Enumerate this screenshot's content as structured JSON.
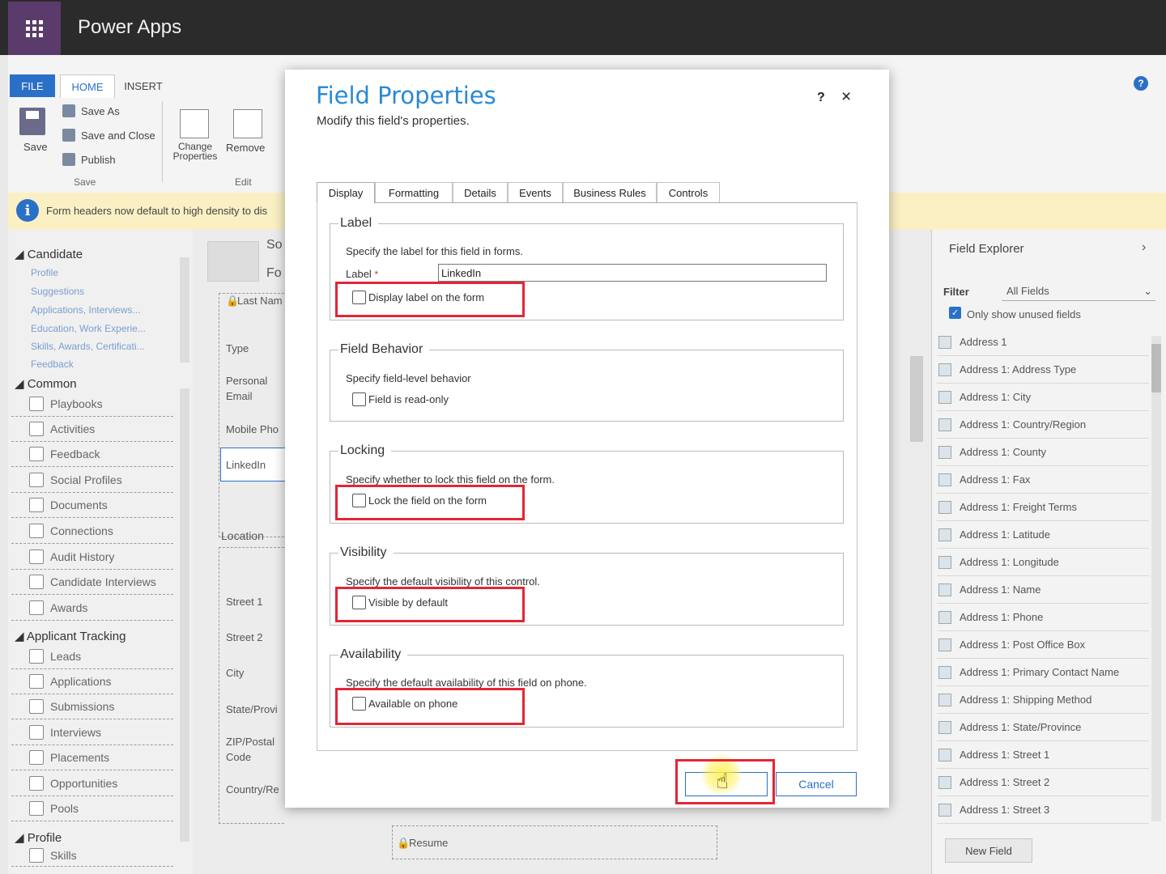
{
  "app": {
    "title": "Power Apps"
  },
  "ribbon": {
    "tabs": [
      "FILE",
      "HOME",
      "INSERT"
    ],
    "save": "Save",
    "save_as": "Save As",
    "save_close": "Save and Close",
    "publish": "Publish",
    "group_save": "Save",
    "change_properties": "Change Properties",
    "remove": "Remove",
    "group_edit": "Edit"
  },
  "banner": {
    "text": "Form headers now default to high density to dis"
  },
  "nav": {
    "candidate": "Candidate",
    "candidate_items": [
      "Profile",
      "Suggestions",
      "Applications, Interviews...",
      "Education, Work Experie...",
      "Skills, Awards, Certificati...",
      "Feedback"
    ],
    "common": "Common",
    "common_items": [
      "Playbooks",
      "Activities",
      "Feedback",
      "Social Profiles",
      "Documents",
      "Connections",
      "Audit History",
      "Candidate Interviews",
      "Awards"
    ],
    "applicant": "Applicant Tracking",
    "applicant_items": [
      "Leads",
      "Applications",
      "Submissions",
      "Interviews",
      "Placements",
      "Opportunities",
      "Pools"
    ],
    "profile": "Profile",
    "profile_items": [
      "Skills"
    ]
  },
  "canvas": {
    "header_frag1": "So",
    "header_frag2": "Fo",
    "last_name": "Last Nam",
    "type": "Type",
    "personal_email_1": "Personal",
    "personal_email_2": "Email",
    "mobile": "Mobile Pho",
    "linkedin": "LinkedIn",
    "location": "Location",
    "street1": "Street 1",
    "street2": "Street 2",
    "city": "City",
    "state": "State/Provi",
    "zip1": "ZIP/Postal",
    "zip2": "Code",
    "country": "Country/Re",
    "resume": "Resume"
  },
  "explorer": {
    "title": "Field Explorer",
    "filter_label": "Filter",
    "filter_value": "All Fields",
    "only_unused": "Only show unused fields",
    "fields": [
      "Address 1",
      "Address 1: Address Type",
      "Address 1: City",
      "Address 1: Country/Region",
      "Address 1: County",
      "Address 1: Fax",
      "Address 1: Freight Terms",
      "Address 1: Latitude",
      "Address 1: Longitude",
      "Address 1: Name",
      "Address 1: Phone",
      "Address 1: Post Office Box",
      "Address 1: Primary Contact Name",
      "Address 1: Shipping Method",
      "Address 1: State/Province",
      "Address 1: Street 1",
      "Address 1: Street 2",
      "Address 1: Street 3"
    ],
    "new_field": "New Field"
  },
  "dialog": {
    "title": "Field Properties",
    "subtitle": "Modify this field's properties.",
    "help": "?",
    "close": "×",
    "tabs": [
      "Display",
      "Formatting",
      "Details",
      "Events",
      "Business Rules",
      "Controls"
    ],
    "label_section": {
      "legend": "Label",
      "desc": "Specify the label for this field in forms.",
      "label_caption": "Label",
      "label_value": "LinkedIn",
      "display_label": "Display label on the form"
    },
    "behavior_section": {
      "legend": "Field Behavior",
      "desc": "Specify field-level behavior",
      "read_only": "Field is read-only"
    },
    "locking_section": {
      "legend": "Locking",
      "desc": "Specify whether to lock this field on the form.",
      "lock": "Lock the field on the form"
    },
    "visibility_section": {
      "legend": "Visibility",
      "desc": "Specify the default visibility of this control.",
      "visible": "Visible by default"
    },
    "availability_section": {
      "legend": "Availability",
      "desc": "Specify the default availability of this field on phone.",
      "available": "Available on phone"
    },
    "cancel": "Cancel"
  }
}
